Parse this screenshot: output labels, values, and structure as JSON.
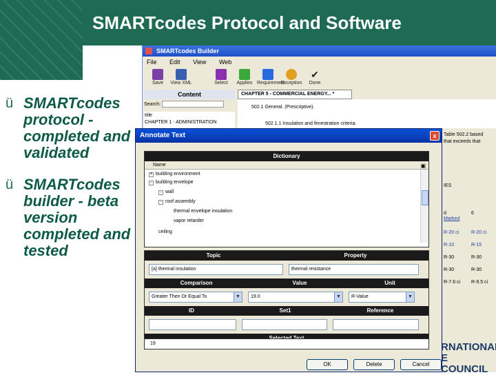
{
  "slide": {
    "title": "SMARTcodes Protocol and Software",
    "bullets": [
      {
        "check": "ü",
        "text": "SMARTcodes protocol - completed and validated"
      },
      {
        "check": "ü",
        "text": "SMARTcodes builder - beta version completed and tested"
      }
    ],
    "logo_text": "RNATIONAL E COUNCIL"
  },
  "builder": {
    "window_title": "SMARTcodes Builder",
    "menu": [
      "File",
      "Edit",
      "View",
      "Web"
    ],
    "toolbar": [
      {
        "label": "Save",
        "color": "#7b3fa8"
      },
      {
        "label": "View XML",
        "color": "#3a5fb0"
      },
      {
        "label": "Select",
        "color": "#8a2fb0"
      },
      {
        "label": "Applies",
        "color": "#3aa83a"
      },
      {
        "label": "Requirement",
        "color": "#2a6ae0"
      },
      {
        "label": "Exception",
        "color": "#e0a020"
      },
      {
        "label": "Done",
        "color": "#222222"
      }
    ],
    "content_header": "Content",
    "search_label": "Search:",
    "tree_label": "title",
    "tree_item": "CHAPTER 1 - ADMINISTRATION",
    "doc_tab": "CHAPTER 5 - COMMERCIAL ENERGY... *",
    "doc_line1": "502.1 General. (Prescriptive).",
    "doc_line2": "502.1.1 Insulation and fenestration criteria.",
    "side": {
      "top1": "Table 502.2 based",
      "top2": "that exceeds that",
      "ies": "IES",
      "col": "d",
      "col2": "Marked",
      "num": "6",
      "r1a": "R-20 ci",
      "r1b": "R-20 ci",
      "r2a": "R-10",
      "r2b": "R-15",
      "r3a": "R-30",
      "r3b": "R-30",
      "r4a": "R-30",
      "r4b": "R-30",
      "r5a": "R-7.6 ci",
      "r5b": "R-9.5 ci"
    }
  },
  "dialog": {
    "title": "Annotate Text",
    "close": "x",
    "dictionary": {
      "header": "Dictionary",
      "col_name": "Name",
      "nodes": [
        {
          "sign": "+",
          "label": "building environment"
        },
        {
          "sign": "-",
          "label": "building envelope"
        },
        {
          "sign": "-",
          "label": "wall"
        },
        {
          "sign": "-",
          "label": "roof assembly"
        },
        {
          "sign": "",
          "label": "thermal envelope insulation"
        },
        {
          "sign": "",
          "label": "vapor retarder"
        },
        {
          "sign": "",
          "label": "ceiling"
        }
      ]
    },
    "topic_header": "Topic",
    "property_header": "Property",
    "topic_value": "[a] thermal insulation",
    "property_value": "thermal resistance",
    "comparison_header": "Comparison",
    "value_header": "Value",
    "unit_header": "Unit",
    "comparison_value": "Greater Then Or Equal To",
    "value_value": "19.0",
    "unit_value": "R-Value",
    "id_header": "ID",
    "set_header": "Set1",
    "reference_header": "Reference",
    "selected_header": "Selected Text",
    "selected_value": "19",
    "buttons": {
      "ok": "OK",
      "delete": "Delete",
      "cancel": "Cancel"
    }
  }
}
